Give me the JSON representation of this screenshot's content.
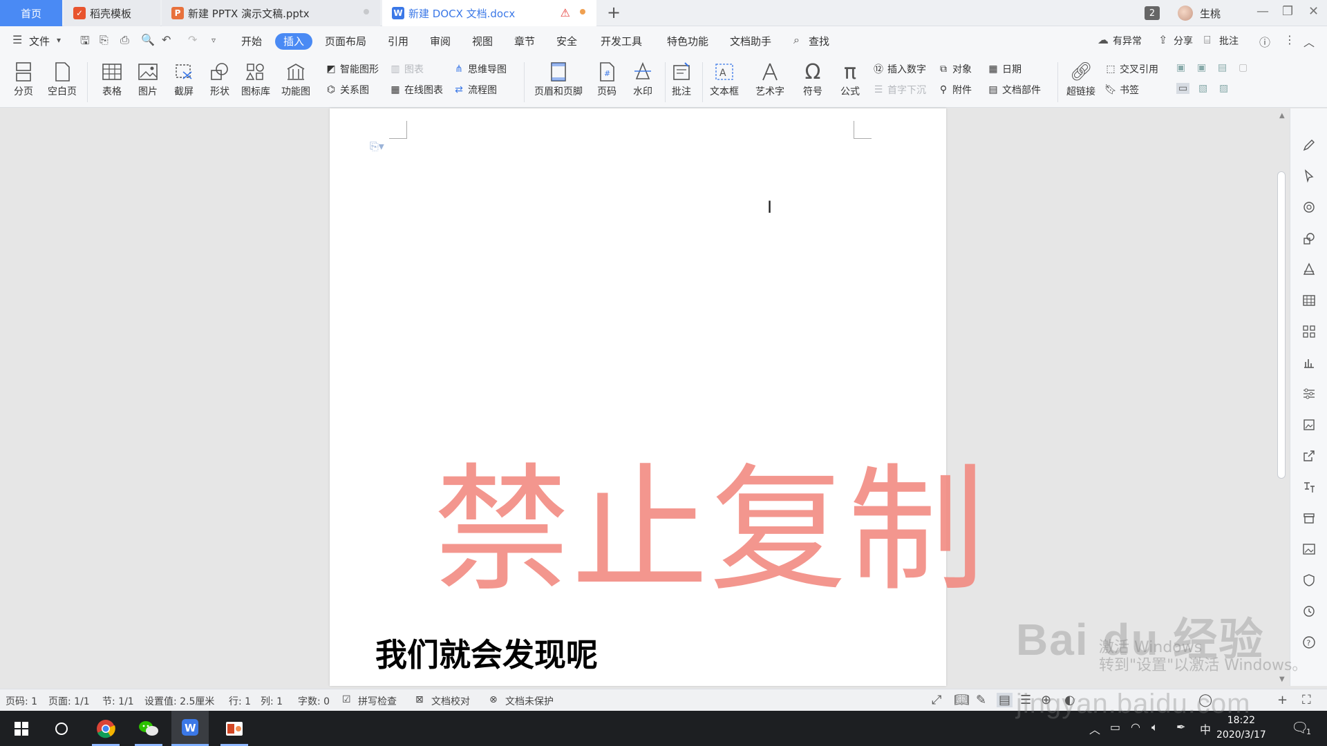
{
  "tabs": {
    "home": "首页",
    "template": "稻壳模板",
    "pptx": "新建 PPTX 演示文稿.pptx",
    "docx": "新建 DOCX 文档.docx"
  },
  "titlebar": {
    "badge_count": "2",
    "user_name": "生桃"
  },
  "menu": {
    "file": "文件",
    "items": [
      "开始",
      "插入",
      "页面布局",
      "引用",
      "审阅",
      "视图",
      "章节",
      "安全",
      "开发工具",
      "特色功能",
      "文档助手"
    ],
    "search": "查找",
    "abnormal": "有异常",
    "share": "分享",
    "comment": "批注"
  },
  "ribbon": {
    "page_break": "分页",
    "blank_page": "空白页",
    "table": "表格",
    "picture": "图片",
    "screenshot": "截屏",
    "shape": "形状",
    "icon_lib": "图标库",
    "func_chart": "功能图",
    "smart_shape": "智能图形",
    "chart": "图表",
    "mind_map": "思维导图",
    "relation": "关系图",
    "online_chart": "在线图表",
    "flowchart": "流程图",
    "header_footer": "页眉和页脚",
    "page_num": "页码",
    "watermark": "水印",
    "annotate": "批注",
    "textbox": "文本框",
    "wordart": "艺术字",
    "symbol": "符号",
    "formula": "公式",
    "insert_number": "插入数字",
    "object": "对象",
    "date": "日期",
    "drop_cap": "首字下沉",
    "attachment": "附件",
    "doc_parts": "文档部件",
    "hyperlink": "超链接",
    "cross_ref": "交叉引用",
    "bookmark": "书签"
  },
  "document": {
    "watermark_text": "禁止复制",
    "body_text": "我们就会发现呢"
  },
  "status": {
    "page_num": "页码: 1",
    "pages": "页面: 1/1",
    "section": "节: 1/1",
    "setting": "设置值: 2.5厘米",
    "row": "行: 1",
    "col": "列: 1",
    "word_count": "字数: 0",
    "spell_check": "拼写检查",
    "doc_proof": "文档校对",
    "doc_protect": "文档未保护"
  },
  "taskbar": {
    "ime": "中",
    "time": "18:22",
    "date": "2020/3/17",
    "notifications": "1"
  },
  "overlay": {
    "baidu_logo": "Bai du 经验",
    "baidu_url": "jingyan.baidu.com",
    "activate_line1": "激活 Windows",
    "activate_line2": "转到\"设置\"以激活 Windows。"
  },
  "colors": {
    "accent": "#4a8af4",
    "watermark": "#f28b82",
    "taskbar": "#1d1f22"
  }
}
